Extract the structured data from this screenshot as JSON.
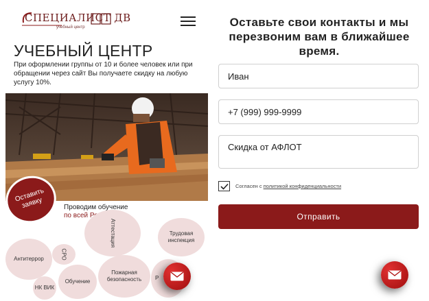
{
  "left": {
    "logo": {
      "text": "СПЕЦИАЛИСТ ДВ",
      "subtitle": "учебный центр"
    },
    "menu_icon": "hamburger-icon",
    "title": "УЧЕБНЫЙ ЦЕНТР",
    "description": "При оформлении группы от 10 и более человек или при обращении через сайт Вы получаете скидку на любую услугу 10%.",
    "cta_label": "Оставить заявку",
    "training": {
      "line1": "Проводим обучение",
      "line2": "по всей России"
    },
    "bubbles": [
      "Аттестация",
      "Трудовая инспекция",
      "Антитеррор",
      "СРО",
      "НК ВИК",
      "Обучение",
      "Пожарная безопасность",
      "Р"
    ],
    "fab_icon": "envelope-icon"
  },
  "form": {
    "heading": "Оставьте свои контакты и мы перезвоним вам в ближайшее время.",
    "name_value": "Иван",
    "phone_value": "+7 (999) 999-9999",
    "comment_value": "Скидка от АФЛОТ",
    "consent_text": "Согласен с",
    "consent_link": "политикой конфиденциальности",
    "consent_checked": true,
    "submit_label": "Отправить",
    "fab_icon": "envelope-icon"
  },
  "colors": {
    "accent": "#8b1a1a",
    "bubble": "#f0dcdc",
    "fab": "#c81a1a"
  }
}
